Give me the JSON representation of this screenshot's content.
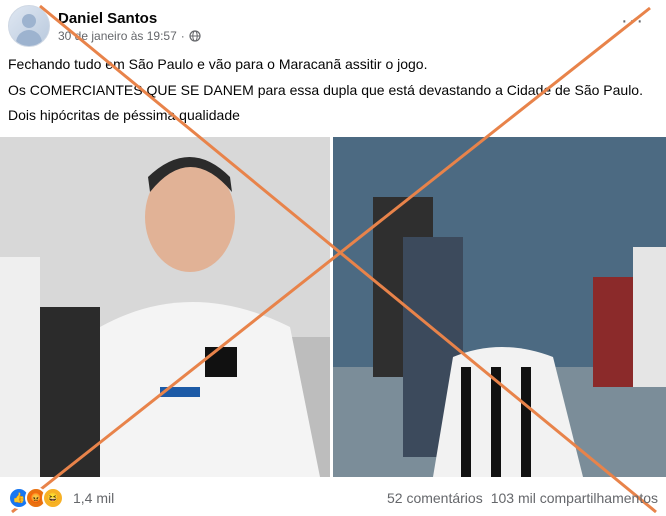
{
  "post": {
    "author": "Daniel Santos",
    "timestamp": "30 de janeiro às 19:57",
    "privacy_icon": "globe-icon",
    "more_icon": "ellipsis-icon",
    "more_label": "···",
    "lines": [
      "Fechando tudo em São Paulo e vão para o Maracanã assitir o jogo.",
      "Os COMERCIANTES QUE SE DANEM para essa dupla que está devastando a Cidade de São Paulo.",
      "Dois hipócritas de péssima qualidade"
    ],
    "photos": [
      "photo-left",
      "photo-right"
    ],
    "overlay_color": "#e8834a"
  },
  "footer": {
    "reaction_icons": [
      "like-icon",
      "angry-icon",
      "haha-icon"
    ],
    "reaction_count": "1,4 mil",
    "comments": "52 comentários",
    "shares": "103 mil compartilhamentos"
  }
}
